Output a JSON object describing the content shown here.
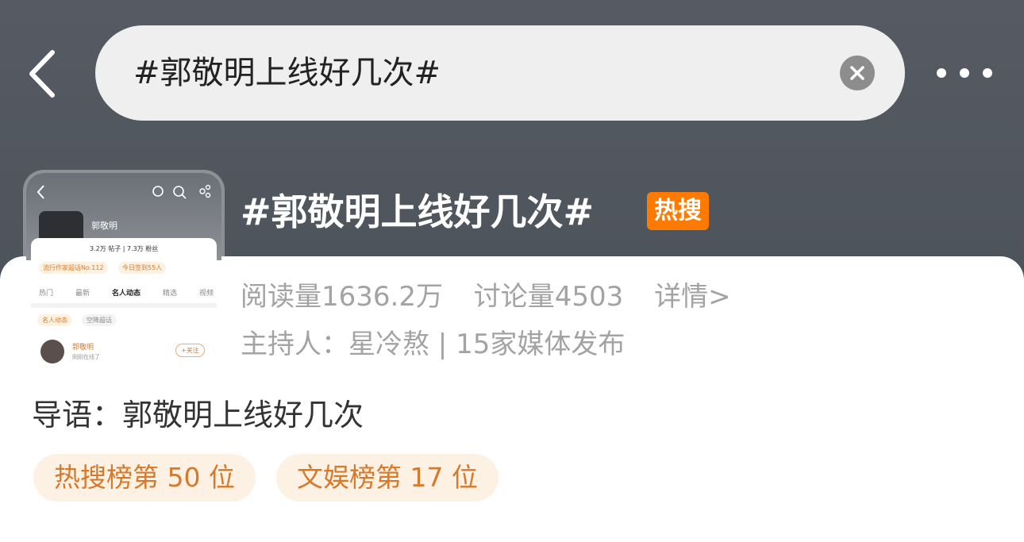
{
  "search": {
    "query": "#郭敬明上线好几次#"
  },
  "topic": {
    "title": "#郭敬明上线好几次#",
    "badge": "热搜",
    "read_count": "阅读量1636.2万",
    "discuss_count": "讨论量4503",
    "detail_link": "详情>",
    "host_line": "主持人：星冷熬 | 15家媒体发布",
    "intro": "导语：郭敬明上线好几次",
    "tags": [
      "热搜榜第 50 位",
      "文娱榜第 17 位"
    ]
  },
  "thumbnail": {
    "name": "郭敬明",
    "stats": "3.2万 帖子 | 7.3万 粉丝",
    "chips": [
      "流行作家超话No.112",
      "今日签到55人"
    ],
    "tabs": [
      "热门",
      "最新",
      "名人动态",
      "精选",
      "视频"
    ],
    "active_tab": "名人动态",
    "filter_chips": [
      "名人动态",
      "空降超话"
    ],
    "user_name": "郭敬明",
    "user_sub": "刚刚在线了",
    "follow": "+关注"
  },
  "colors": {
    "accent": "#ff7a00",
    "tag_bg": "#fdf1e4",
    "tag_text": "#d8792a",
    "header_bg": "#51565e"
  }
}
